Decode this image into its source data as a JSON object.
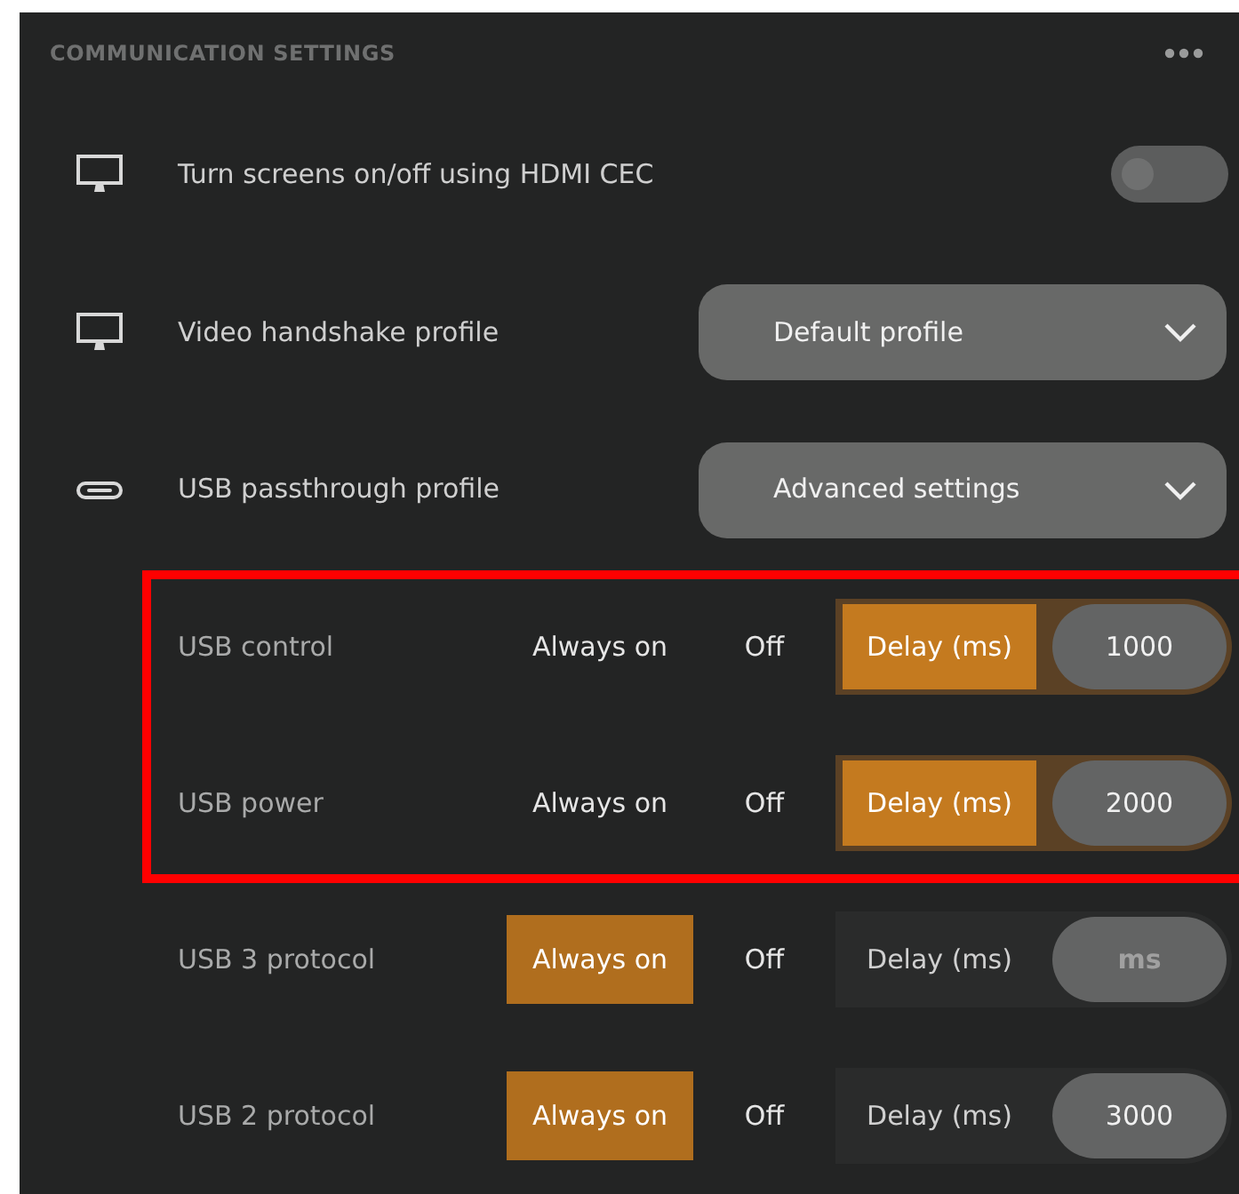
{
  "header": {
    "title": "COMMUNICATION SETTINGS"
  },
  "settings": [
    {
      "kind": "toggle",
      "label": "Turn screens on/off using HDMI CEC",
      "on": false
    },
    {
      "kind": "dropdown",
      "label": "Video handshake profile",
      "value": "Default profile"
    },
    {
      "kind": "dropdown",
      "label": "USB passthrough profile",
      "value": "Advanced settings"
    }
  ],
  "usb_rows": [
    {
      "label": "USB control",
      "highlighted": true,
      "options": [
        {
          "label": "Always on",
          "selected": false
        },
        {
          "label": "Off",
          "selected": false
        },
        {
          "label": "Delay (ms)",
          "selected": true
        }
      ],
      "delay": {
        "value": "1000"
      }
    },
    {
      "label": "USB power",
      "highlighted": true,
      "options": [
        {
          "label": "Always on",
          "selected": false
        },
        {
          "label": "Off",
          "selected": false
        },
        {
          "label": "Delay (ms)",
          "selected": true
        }
      ],
      "delay": {
        "value": "2000"
      }
    },
    {
      "label": "USB 3 protocol",
      "highlighted": false,
      "options": [
        {
          "label": "Always on",
          "selected": true
        },
        {
          "label": "Off",
          "selected": false
        },
        {
          "label": "Delay (ms)",
          "selected": false
        }
      ],
      "delay": {
        "placeholder": "ms"
      }
    },
    {
      "label": "USB 2 protocol",
      "highlighted": false,
      "options": [
        {
          "label": "Always on",
          "selected": true
        },
        {
          "label": "Off",
          "selected": false
        },
        {
          "label": "Delay (ms)",
          "selected": false
        }
      ],
      "delay": {
        "value": "3000"
      }
    }
  ]
}
